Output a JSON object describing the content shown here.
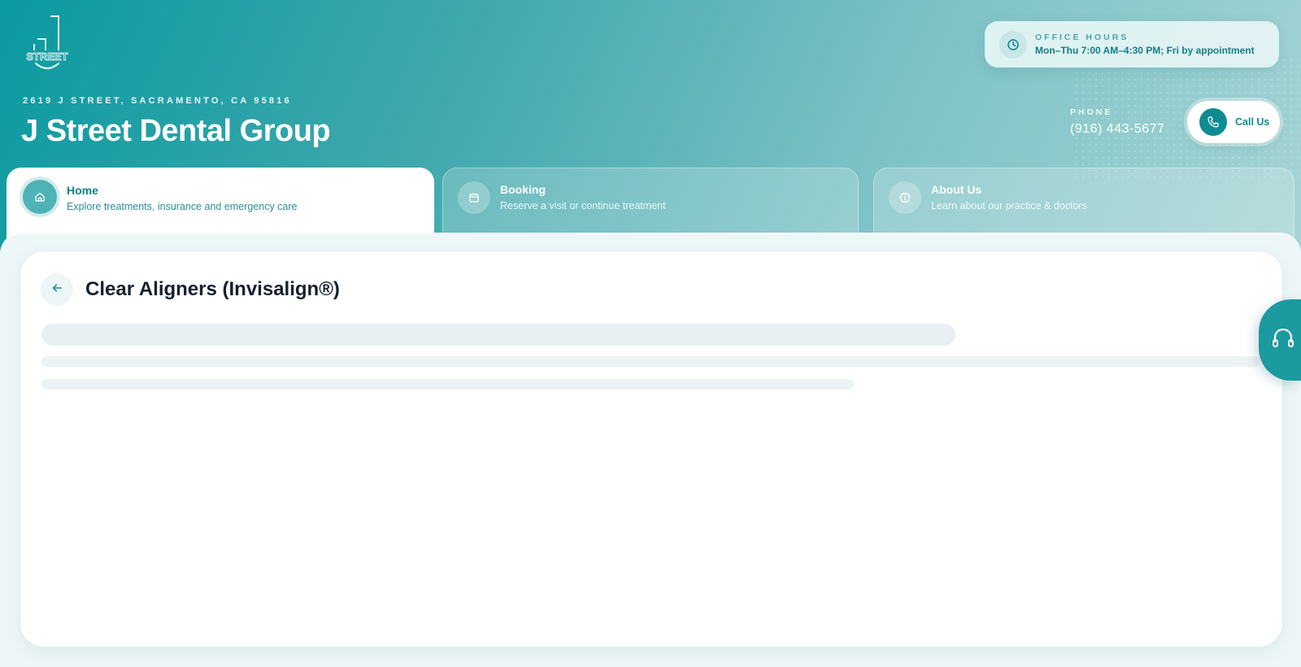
{
  "brand": {
    "logo_text": "STREET",
    "address": "2619 J STREET, SACRAMENTO, CA 95816",
    "name": "J Street Dental Group"
  },
  "office_hours": {
    "label": "OFFICE HOURS",
    "value": "Mon–Thu 7:00 AM–4:30 PM; Fri by appointment",
    "icon": "clock-icon"
  },
  "phone": {
    "label": "PHONE",
    "number": "(916) 443-5677",
    "call_label": "Call Us",
    "icon": "phone-icon"
  },
  "tabs": [
    {
      "title": "Home",
      "subtitle": "Explore treatments, insurance and emergency care",
      "icon": "home-icon",
      "active": true
    },
    {
      "title": "Booking",
      "subtitle": "Reserve a visit or continue treatment",
      "icon": "calendar-icon",
      "active": false
    },
    {
      "title": "About Us",
      "subtitle": "Learn about our practice & doctors",
      "icon": "info-icon",
      "active": false
    }
  ],
  "content": {
    "title": "Clear Aligners (Invisalign®)",
    "back_icon": "arrow-left-icon",
    "loading": true
  },
  "support": {
    "icon": "headset-icon"
  },
  "colors": {
    "accent": "#0e8c93",
    "accent_light": "#4fb2b6",
    "title_dark": "#16202e",
    "skeleton": "#e9eff3"
  }
}
